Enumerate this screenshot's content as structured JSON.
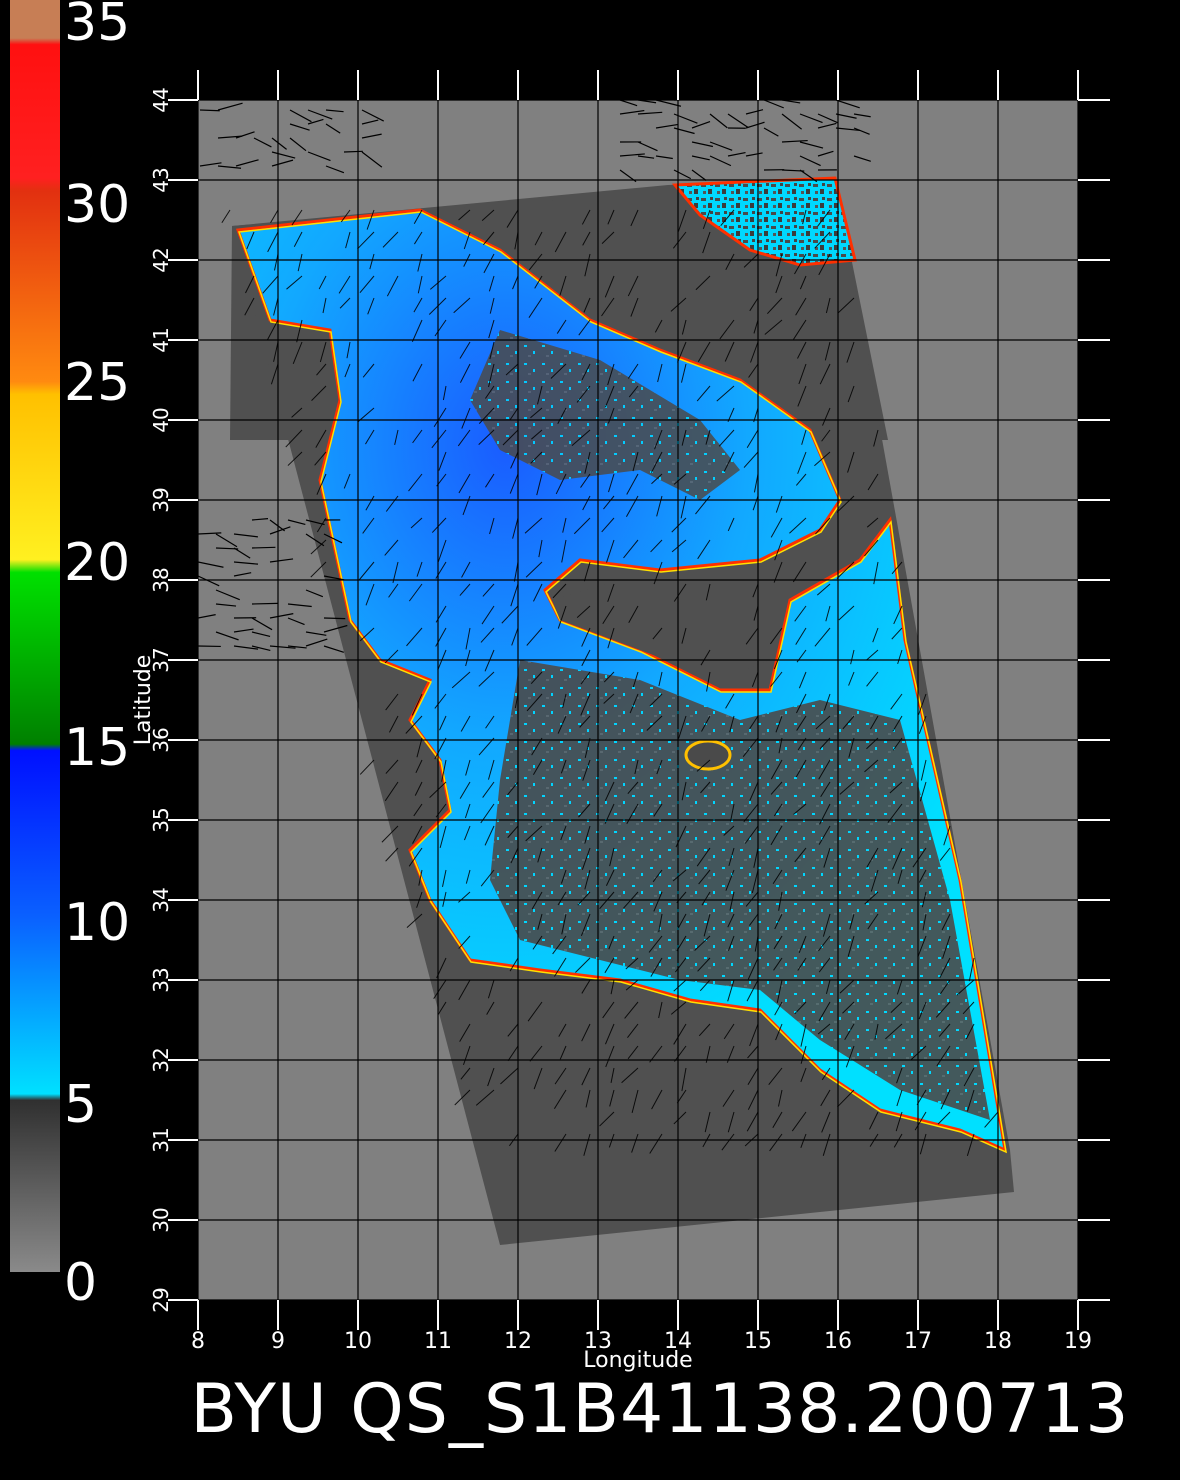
{
  "title": "BYU  QS_S1B41138.200713",
  "colorbar": {
    "labels": [
      "35",
      "30",
      "25",
      "20",
      "15",
      "10",
      "5",
      "0"
    ],
    "colors": {
      "top": "#c77e55",
      "red": "#ff1010",
      "orange": "#ff8010",
      "yellow": "#ffe000",
      "green": "#00c000",
      "blue": "#0030ff",
      "cyan": "#00f0ff",
      "gray": "#707070"
    }
  },
  "axes": {
    "xlabel": "Longitude",
    "ylabel": "Latitude",
    "lon_ticks": [
      "8",
      "9",
      "10",
      "11",
      "12",
      "13",
      "14",
      "15",
      "16",
      "17",
      "18",
      "19"
    ],
    "lat_ticks": [
      "29",
      "30",
      "31",
      "32",
      "33",
      "34",
      "35",
      "36",
      "37",
      "38",
      "39",
      "40",
      "41",
      "42",
      "43",
      "44"
    ],
    "lon_range": [
      8,
      19
    ],
    "lat_range": [
      29,
      44
    ]
  },
  "map_colors": {
    "background": "#000000",
    "plot_fill": "#808080",
    "swath": "#505050",
    "ocean_low": "#00e6ff",
    "ocean_high": "#1e6eff",
    "land": "#4a4a4a",
    "grid": "#000000"
  }
}
